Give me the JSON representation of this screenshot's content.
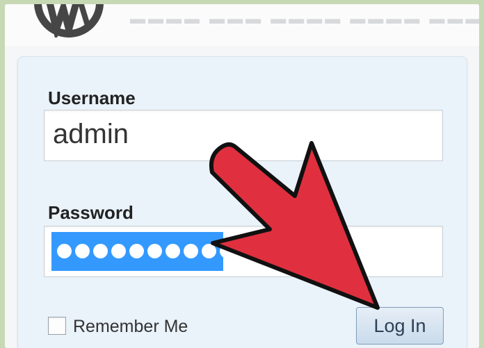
{
  "form": {
    "username_label": "Username",
    "username_value": "admin",
    "password_label": "Password",
    "password_masked": "●●●●●●●●●●",
    "remember_label": "Remember Me",
    "remember_checked": false,
    "login_button": "Log In"
  },
  "annotation": {
    "type": "pointer-arrow",
    "color": "#e0303f"
  },
  "icons": [
    "wordpress-logo-icon",
    "red-pointer-arrow-icon"
  ]
}
